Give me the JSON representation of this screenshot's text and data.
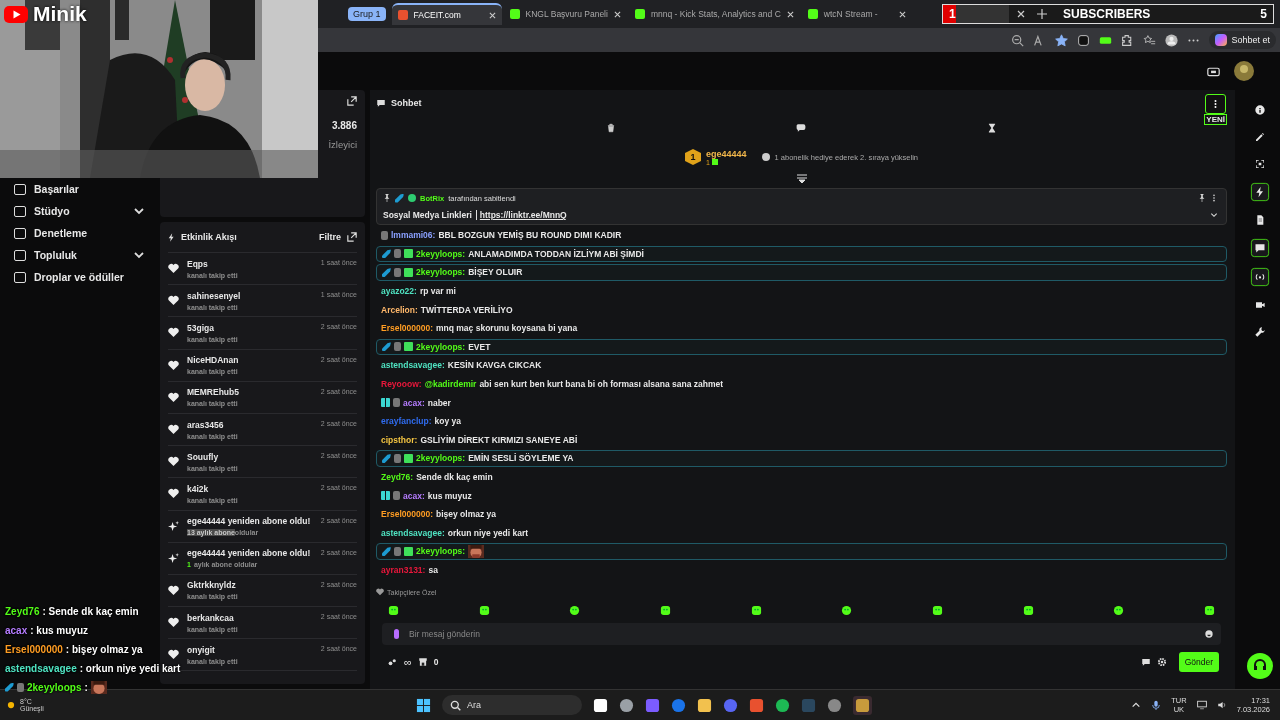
{
  "stream_overlay": {
    "logo_text": "Minik",
    "subscribers": {
      "current": "1",
      "label": "SUBSCRIBERS",
      "goal": "5",
      "level": 0.2
    },
    "chat": [
      {
        "user": "Zeyd76",
        "color": "#53fc18",
        "text": ": Sende dk kaç emin",
        "kind": "text"
      },
      {
        "user": "acax",
        "color": "#b57cff",
        "text": ": kus muyuz",
        "kind": "text"
      },
      {
        "user": "Ersel000000",
        "color": "#ff9d23",
        "text": ": bişey olmaz ya",
        "kind": "text"
      },
      {
        "user": "astendsavagee",
        "color": "#4fe3c2",
        "text": ": orkun niye yedi kart",
        "kind": "text"
      },
      {
        "user": "2keyyloops",
        "color": "#53fc18",
        "text": ":",
        "kind": "emote"
      }
    ]
  },
  "browser": {
    "tab_group": "Grup 1",
    "tabs": [
      {
        "title": "FACEIT.com",
        "selected": true
      },
      {
        "title": "KNGL Başvuru Paneli",
        "selected": false
      },
      {
        "title": "mnnq - Kick Stats, Analytics and C",
        "selected": false
      },
      {
        "title": "wtcN Stream -",
        "selected": false
      }
    ],
    "copilot_label": "Sohbet et",
    "favorite": true
  },
  "sidebar": {
    "items": [
      {
        "label": "Başarılar",
        "expandable": false
      },
      {
        "label": "Stüdyo",
        "expandable": true
      },
      {
        "label": "Denetleme",
        "expandable": false
      },
      {
        "label": "Topluluk",
        "expandable": true
      },
      {
        "label": "Droplar ve ödüller",
        "expandable": false
      }
    ]
  },
  "stats": {
    "value": "3.886",
    "label": "İzleyici"
  },
  "activity": {
    "title": "Etkinlik Akışı",
    "filter": "Filtre",
    "items": [
      {
        "kind": "follow",
        "user": "Eqps",
        "detail": "kanalı takip etti",
        "time": "1 saat önce"
      },
      {
        "kind": "follow",
        "user": "sahinesenyel",
        "detail": "kanalı takip etti",
        "time": "1 saat önce"
      },
      {
        "kind": "follow",
        "user": "53giga",
        "detail": "kanalı takip etti",
        "time": "2 saat önce"
      },
      {
        "kind": "follow",
        "user": "NiceHDAnan",
        "detail": "kanalı takip etti",
        "time": "2 saat önce"
      },
      {
        "kind": "follow",
        "user": "MEMREhub5",
        "detail": "kanalı takip etti",
        "time": "2 saat önce"
      },
      {
        "kind": "follow",
        "user": "aras3456",
        "detail": "kanalı takip etti",
        "time": "2 saat önce"
      },
      {
        "kind": "follow",
        "user": "Souufly",
        "detail": "kanalı takip etti",
        "time": "2 saat önce"
      },
      {
        "kind": "follow",
        "user": "k4i2k",
        "detail": "kanalı takip etti",
        "time": "2 saat önce"
      },
      {
        "kind": "resub",
        "user": "ege44444 yeniden abone oldu!",
        "lead": "13 aylık abone",
        "lead_highlighted": true,
        "detail": "oldular",
        "time": "2 saat önce"
      },
      {
        "kind": "resub",
        "user": "ege44444 yeniden abone oldu!",
        "lead": "1",
        "lead_highlighted": false,
        "detail": "aylık abone oldular",
        "time": "2 saat önce"
      },
      {
        "kind": "follow",
        "user": "Gktrkknyldz",
        "detail": "kanalı takip etti",
        "time": "2 saat önce"
      },
      {
        "kind": "follow",
        "user": "berkankcaa",
        "detail": "kanalı takip etti",
        "time": "2 saat önce"
      },
      {
        "kind": "follow",
        "user": "onyigit",
        "detail": "kanalı takip etti",
        "time": "2 saat önce"
      }
    ]
  },
  "chat": {
    "title": "Sohbet",
    "new_label": "YENİ",
    "leader": {
      "rank": "1",
      "user": "ege44444",
      "count": "1",
      "hint": "1 abonelik hediye ederek 2. sıraya yükselin"
    },
    "pinned": {
      "by": "BotRix",
      "by_suffix": "tarafından sabitlendi",
      "title": "Sosyal Medya Linkleri",
      "link": "https://linktr.ee/MnnQ"
    },
    "messages": [
      {
        "user": "lmmami06:",
        "color": "#8aa0ff",
        "text": "BBL BOZGUN YEMİŞ BU ROUND DIMI KADIR",
        "kind": "subscriber"
      },
      {
        "user": "2keyyloops:",
        "color": "#53fc18",
        "text": "ANLAMADIMDA TODDAN İZLİYM ABİ ŞİMDİ",
        "kind": "gifter"
      },
      {
        "user": "2keyyloops:",
        "color": "#53fc18",
        "text": "BİŞEY OLUIR",
        "kind": "gifter"
      },
      {
        "user": "ayazo22:",
        "color": "#4fe3c2",
        "text": "rp var mi",
        "kind": "plain"
      },
      {
        "user": "Arcelion:",
        "color": "#ffb86b",
        "text": "TWİTTERDA VERİLİYO",
        "kind": "plain"
      },
      {
        "user": "Ersel000000:",
        "color": "#ff9d23",
        "text": "mnq maç skorunu koysana bi yana",
        "kind": "plain"
      },
      {
        "user": "2keyyloops:",
        "color": "#53fc18",
        "text": "EVET",
        "kind": "gifter"
      },
      {
        "user": "astendsavagee:",
        "color": "#4fe3c2",
        "text": "KESİN KAVGA CIKCAK",
        "kind": "plain"
      },
      {
        "user": "Reyooow:",
        "color": "#e8173b",
        "mention": "@kadirdemir",
        "text": "abi sen kurt ben kurt bana bi oh forması alsana sana zahmet",
        "kind": "plain"
      },
      {
        "user": "acax:",
        "color": "#b57cff",
        "text": "naber",
        "kind": "member"
      },
      {
        "user": "erayfanclup:",
        "color": "#2f6cf0",
        "text": "koy ya",
        "kind": "plain"
      },
      {
        "user": "cipsthor:",
        "color": "#f4c542",
        "text": "GSLİYİM DİREKT KIRMIZI SANEYE ABİ",
        "kind": "plain"
      },
      {
        "user": "2keyyloops:",
        "color": "#53fc18",
        "text": "EMİN SESLİ SÖYLEME YA",
        "kind": "gifter"
      },
      {
        "user": "Zeyd76:",
        "color": "#53fc18",
        "text": "Sende dk kaç emin",
        "kind": "plain"
      },
      {
        "user": "acax:",
        "color": "#b57cff",
        "text": "kus muyuz",
        "kind": "member"
      },
      {
        "user": "Ersel000000:",
        "color": "#ff9d23",
        "text": "bişey olmaz ya",
        "kind": "plain"
      },
      {
        "user": "astendsavagee:",
        "color": "#4fe3c2",
        "text": "orkun niye yedi kart",
        "kind": "plain"
      },
      {
        "user": "2keyyloops:",
        "color": "#53fc18",
        "emote": true,
        "kind": "gifter"
      },
      {
        "user": "ayran3131:",
        "color": "#e8173b",
        "text": "sa",
        "kind": "plain"
      }
    ],
    "followers_label": "Takipçilere Özel",
    "input": {
      "placeholder": "Bir mesaj gönderin"
    },
    "infinity": "∞",
    "points": "0",
    "send": "Gönder"
  },
  "rail": [
    {
      "kind": "info",
      "boxed": false
    },
    {
      "kind": "pencil",
      "boxed": false
    },
    {
      "kind": "focus",
      "boxed": false
    },
    {
      "kind": "bolt",
      "boxed": true
    },
    {
      "kind": "document",
      "boxed": false
    },
    {
      "kind": "chat",
      "boxed": true
    },
    {
      "kind": "broadcast",
      "boxed": true
    },
    {
      "kind": "video",
      "boxed": false
    },
    {
      "kind": "wrench",
      "boxed": false
    }
  ],
  "taskbar": {
    "search": "Ara",
    "weather": {
      "temp": "8°C",
      "text": "Güneşli"
    },
    "lang": "TUR",
    "layout": "UK",
    "time": "17:31",
    "date": "7.03.2026"
  }
}
